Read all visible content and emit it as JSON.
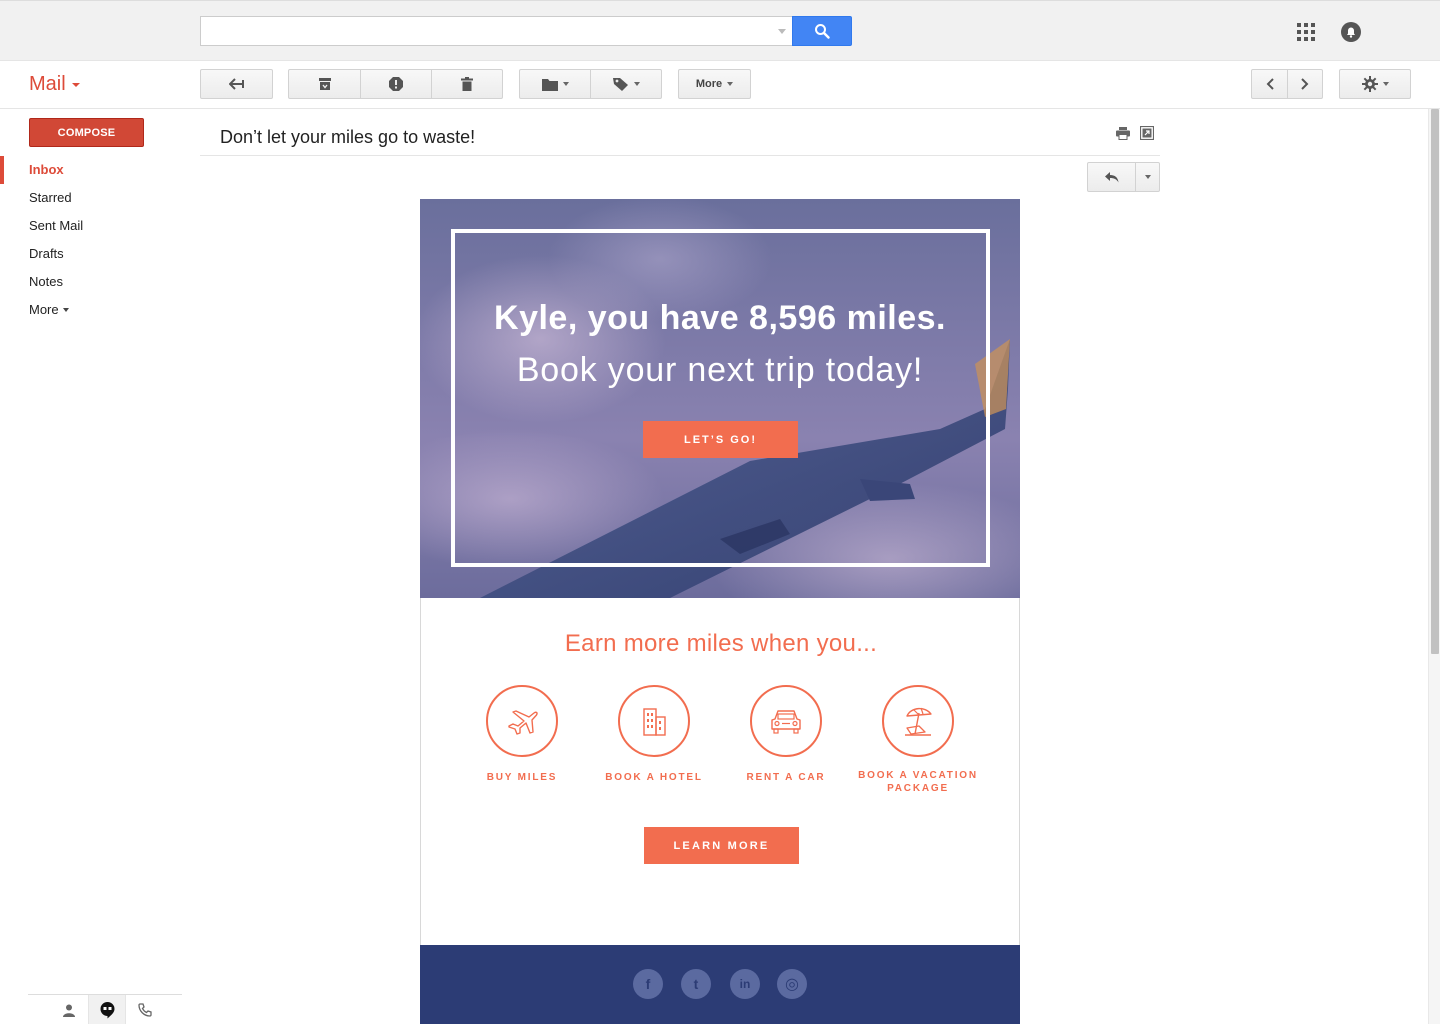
{
  "header": {
    "search": {
      "value": "",
      "placeholder": ""
    },
    "icons": [
      "search-icon",
      "apps-grid-icon",
      "notifications-icon"
    ]
  },
  "app": {
    "label": "Mail"
  },
  "toolbar": {
    "more_label": "More",
    "icons": [
      "back-arrow-icon",
      "archive-icon",
      "report-spam-icon",
      "delete-icon",
      "move-to-folder-icon",
      "labels-icon",
      "chevron-left-icon",
      "chevron-right-icon",
      "settings-gear-icon"
    ]
  },
  "sidebar": {
    "compose_label": "COMPOSE",
    "items": [
      {
        "label": "Inbox",
        "active": true
      },
      {
        "label": "Starred"
      },
      {
        "label": "Sent Mail"
      },
      {
        "label": "Drafts"
      },
      {
        "label": "Notes"
      },
      {
        "label": "More"
      }
    ],
    "footer_icons": [
      "contacts-icon",
      "hangouts-icon",
      "phone-icon"
    ]
  },
  "message": {
    "subject": "Don’t let your miles go to waste!"
  },
  "email": {
    "hero": {
      "line1": "Kyle, you have 8,596 miles.",
      "line2": "Book your next trip today!",
      "cta": "LET’S GO!"
    },
    "earn_title": "Earn more miles when you...",
    "features": [
      {
        "label": "BUY MILES",
        "icon": "airplane-icon"
      },
      {
        "label": "BOOK A HOTEL",
        "icon": "hotel-building-icon"
      },
      {
        "label": "RENT A CAR",
        "icon": "car-icon"
      },
      {
        "label": "BOOK A VACATION PACKAGE",
        "icon": "beach-umbrella-icon"
      }
    ],
    "learn_more": "LEARN MORE",
    "social": [
      {
        "name": "facebook",
        "glyph": "f"
      },
      {
        "name": "twitter",
        "glyph": "t"
      },
      {
        "name": "linkedin",
        "glyph": "in"
      },
      {
        "name": "instagram",
        "glyph": "◎"
      }
    ]
  },
  "colors": {
    "gmail_red": "#dd4b39",
    "search_blue": "#4285f4",
    "email_orange": "#f26d4f",
    "email_navy": "#2c3c75"
  }
}
